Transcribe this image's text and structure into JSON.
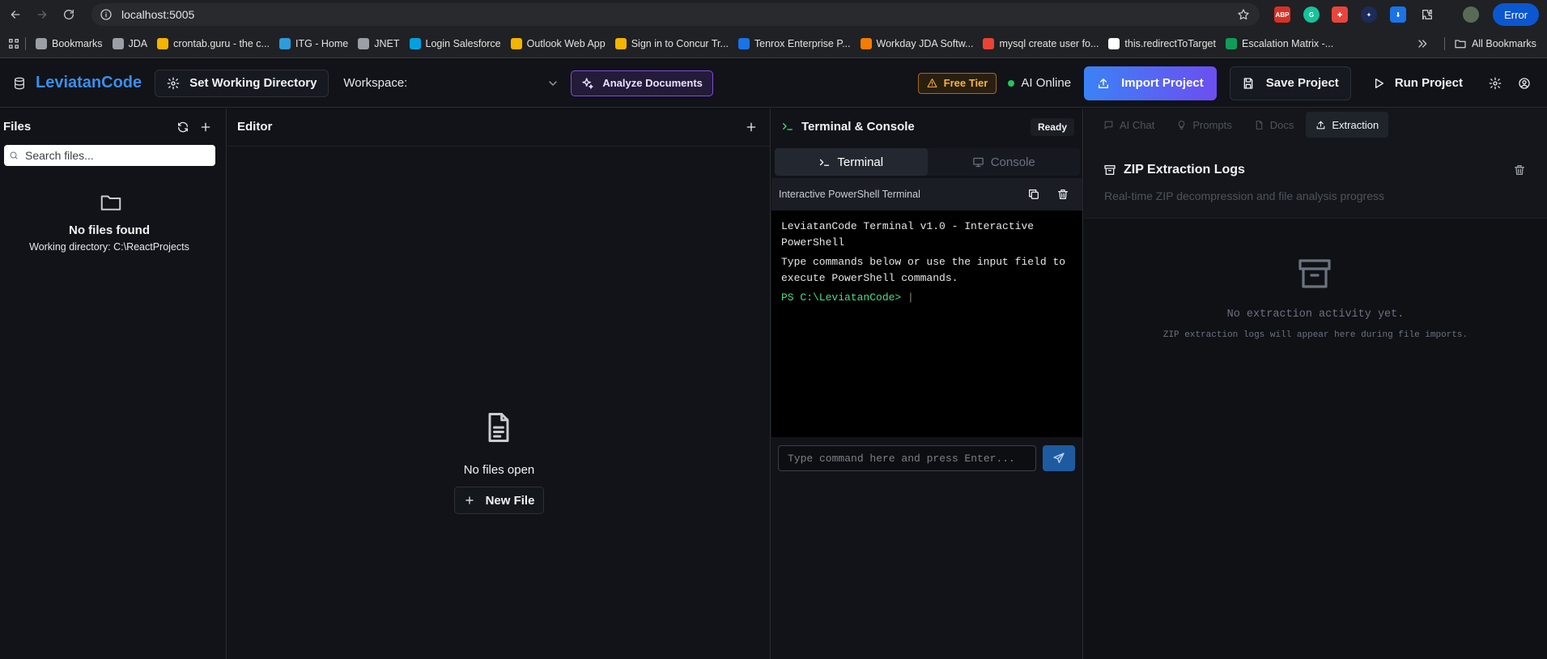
{
  "browser": {
    "url": "localhost:5005",
    "profile_button": "Error",
    "bookmarks": [
      {
        "label": "Bookmarks",
        "color": "#9aa0a6"
      },
      {
        "label": "JDA",
        "color": "#9aa0a6"
      },
      {
        "label": "crontab.guru - the c...",
        "color": "#f4b400"
      },
      {
        "label": "ITG - Home",
        "color": "#2d9cdb"
      },
      {
        "label": "JNET",
        "color": "#9aa0a6"
      },
      {
        "label": "Login  Salesforce",
        "color": "#00a1e0"
      },
      {
        "label": "Outlook Web App",
        "color": "#f4b400"
      },
      {
        "label": "Sign in to Concur Tr...",
        "color": "#f4b400"
      },
      {
        "label": "Tenrox Enterprise P...",
        "color": "#1a73e8"
      },
      {
        "label": "Workday JDA Softw...",
        "color": "#f57c00"
      },
      {
        "label": "mysql create user fo...",
        "color": "#ea4335"
      },
      {
        "label": "this.redirectToTarget",
        "color": "#ffffff"
      },
      {
        "label": "Escalation Matrix -...",
        "color": "#0f9d58"
      }
    ],
    "all_bookmarks": "All Bookmarks"
  },
  "header": {
    "brand": "LeviatanCode",
    "set_working_directory": "Set Working Directory",
    "workspace_label": "Workspace:",
    "workspace_value": "",
    "analyze_documents": "Analyze Documents",
    "free_tier": "Free Tier",
    "ai_status": "AI Online",
    "import_project": "Import Project",
    "save_project": "Save Project",
    "run_project": "Run Project"
  },
  "files": {
    "title": "Files",
    "search_placeholder": "Search files...",
    "empty_title": "No files found",
    "working_directory": "Working directory: C:\\ReactProjects"
  },
  "editor": {
    "title": "Editor",
    "empty_title": "No files open",
    "new_file": "New File"
  },
  "terminal": {
    "title": "Terminal & Console",
    "status": "Ready",
    "tabs": [
      "Terminal",
      "Console"
    ],
    "subtitle": "Interactive PowerShell Terminal",
    "lines": [
      "LeviatanCode Terminal v1.0 - Interactive PowerShell",
      "Type commands below or use the input field to execute PowerShell commands."
    ],
    "prompt": "PS C:\\LeviatanCode> ",
    "input_placeholder": "Type command here and press Enter..."
  },
  "right_panel": {
    "tabs": [
      "AI Chat",
      "Prompts",
      "Docs",
      "Extraction"
    ],
    "active_tab": "Extraction",
    "title": "ZIP Extraction Logs",
    "subtitle": "Real-time ZIP decompression and file analysis progress",
    "empty_title": "No extraction activity yet.",
    "empty_subtitle": "ZIP extraction logs will appear here during file imports."
  },
  "colors": {
    "brand": "#3b8eea",
    "online": "#22c55e",
    "prompt": "#4ade80"
  }
}
